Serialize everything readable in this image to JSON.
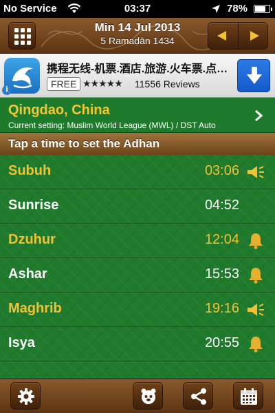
{
  "status_bar": {
    "carrier": "No Service",
    "time": "03:37",
    "battery_percent": "78%",
    "battery_level": 0.78
  },
  "header": {
    "date": "Min 14 Jul 2013",
    "hijri_date": "5 Ramaḍān 1434"
  },
  "ad": {
    "title": "携程无线-机票.酒店.旅游.火车票.点…",
    "price_badge": "FREE",
    "rating_stars": "★★★★★",
    "rating_value": 4.5,
    "reviews": "11556 Reviews",
    "info_glyph": "i"
  },
  "location": {
    "city": "Qingdao, China",
    "setting": "Current setting: Muslim World League (MWL) / DST Auto"
  },
  "section": {
    "title": "Tap a time to set the Adhan"
  },
  "prayers": [
    {
      "name": "Subuh",
      "time": "03:06",
      "highlight": true,
      "alert_icon": "speaker-icon"
    },
    {
      "name": "Sunrise",
      "time": "04:52",
      "highlight": false,
      "alert_icon": "none"
    },
    {
      "name": "Dzuhur",
      "time": "12:04",
      "highlight": true,
      "alert_icon": "bell-icon"
    },
    {
      "name": "Ashar",
      "time": "15:53",
      "highlight": false,
      "alert_icon": "bell-icon"
    },
    {
      "name": "Maghrib",
      "time": "19:16",
      "highlight": true,
      "alert_icon": "speaker-icon"
    },
    {
      "name": "Isya",
      "time": "20:55",
      "highlight": false,
      "alert_icon": "bell-icon"
    }
  ],
  "colors": {
    "gold": "#f2c233",
    "green": "#1f7a2b",
    "brown": "#6b4418"
  },
  "toolbar": {
    "icons": [
      "gear-icon",
      "qibla-compass-icon",
      "share-icon",
      "calendar-icon"
    ]
  }
}
